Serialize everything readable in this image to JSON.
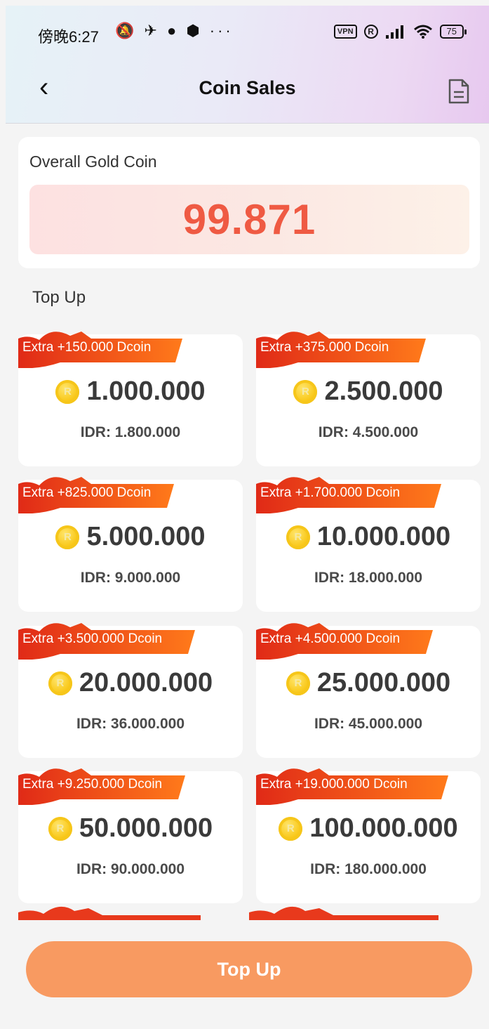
{
  "status_bar": {
    "time": "傍晚6:27",
    "left_icons": "🔕 ✈ ● ⬢ ···",
    "vpn": "VPN",
    "r_icon": "R",
    "battery": "75"
  },
  "header": {
    "title": "Coin Sales",
    "back_icon": "chevron-left-icon",
    "record_icon": "document-icon"
  },
  "overall": {
    "label": "Overall Gold Coin",
    "value": "99.871"
  },
  "section_title": "Top Up",
  "packages": [
    {
      "extra": "Extra +150.000 Dcoin",
      "coins": "1.000.000",
      "price": "IDR: 1.800.000"
    },
    {
      "extra": "Extra +375.000 Dcoin",
      "coins": "2.500.000",
      "price": "IDR: 4.500.000"
    },
    {
      "extra": "Extra +825.000 Dcoin",
      "coins": "5.000.000",
      "price": "IDR: 9.000.000"
    },
    {
      "extra": "Extra +1.700.000 Dcoin",
      "coins": "10.000.000",
      "price": "IDR: 18.000.000"
    },
    {
      "extra": "Extra +3.500.000 Dcoin",
      "coins": "20.000.000",
      "price": "IDR: 36.000.000"
    },
    {
      "extra": "Extra +4.500.000 Dcoin",
      "coins": "25.000.000",
      "price": "IDR: 45.000.000"
    },
    {
      "extra": "Extra +9.250.000 Dcoin",
      "coins": "50.000.000",
      "price": "IDR: 90.000.000"
    },
    {
      "extra": "Extra +19.000.000 Dcoin",
      "coins": "100.000.000",
      "price": "IDR: 180.000.000"
    }
  ],
  "coin_symbol": "R",
  "topup_button": "Top Up",
  "colors": {
    "accent": "#f89a61",
    "value": "#ef5a43",
    "ribbon": "#e8391c"
  }
}
